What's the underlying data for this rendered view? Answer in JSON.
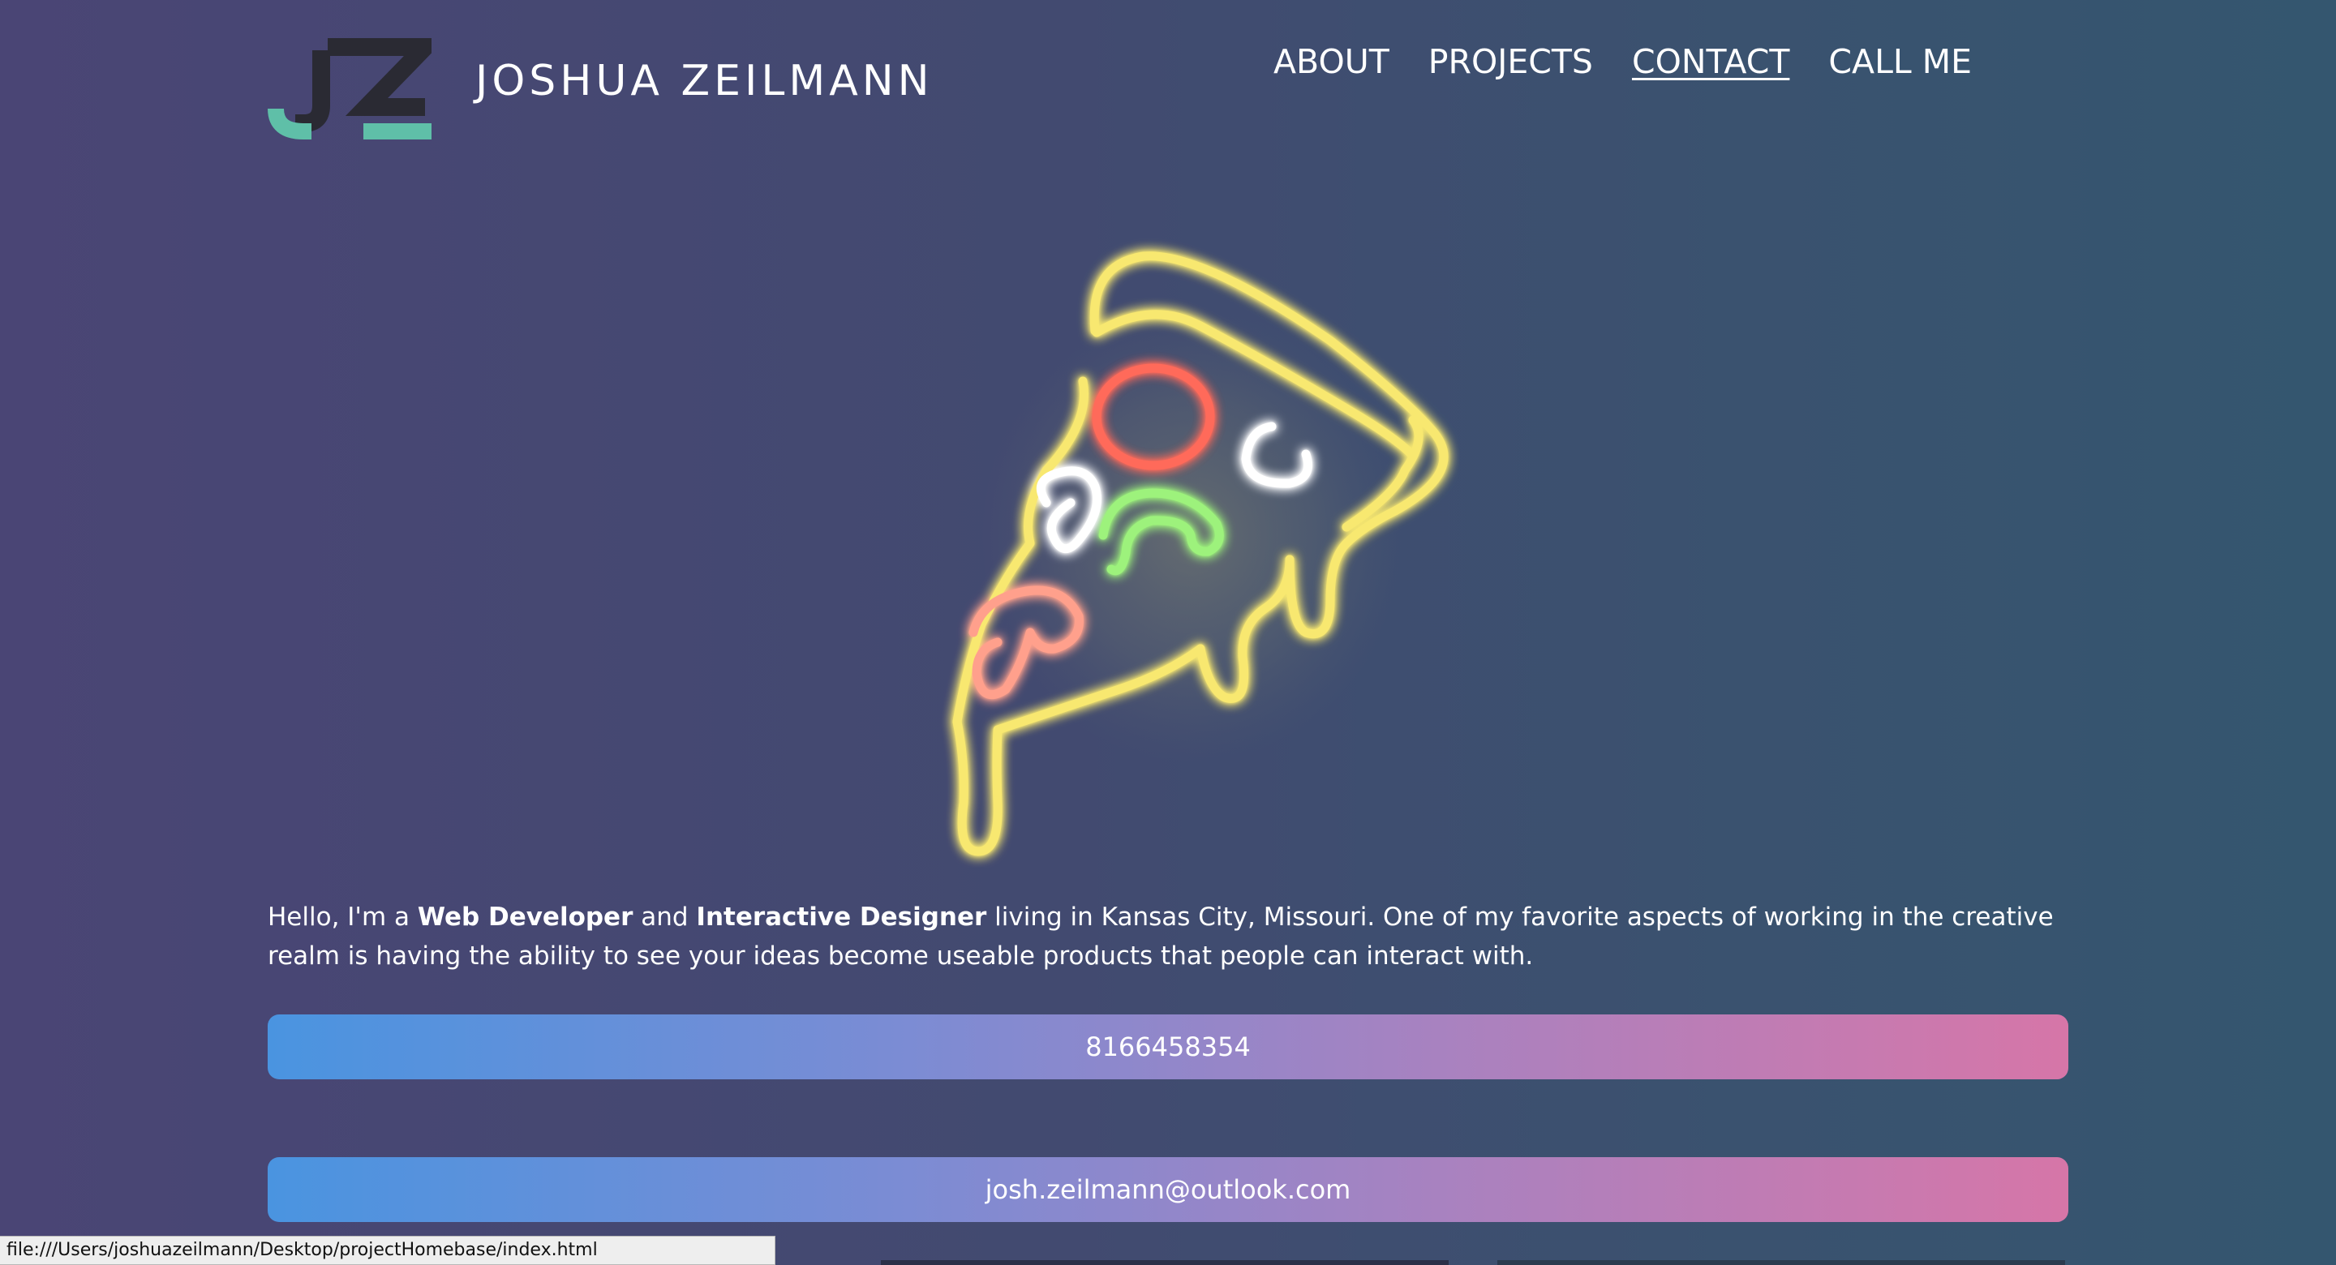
{
  "header": {
    "logo_icon": "jz-monogram-icon",
    "site_name": "JOSHUA ZEILMANN",
    "nav": [
      {
        "label": "ABOUT",
        "active": false
      },
      {
        "label": "PROJECTS",
        "active": false
      },
      {
        "label": "CONTACT",
        "active": true
      },
      {
        "label": "CALL ME",
        "active": false
      }
    ]
  },
  "hero": {
    "illustration": "neon-pizza-slice-icon"
  },
  "intro": {
    "part1": "Hello, I'm a ",
    "role1": "Web Developer",
    "part2": " and ",
    "role2": "Interactive Designer",
    "part3": " living in Kansas City, Missouri. One of my favorite aspects of working in the creative realm is having the ability to see your ideas become useable products that people can interact with."
  },
  "contact": {
    "phone": "8166458354",
    "email": "josh.zeilmann@outlook.com"
  },
  "status_bar": {
    "url": "file:///Users/joshuazeilmann/Desktop/projectHomebase/index.html"
  },
  "colors": {
    "background_start": "#4a4575",
    "background_end": "#34566f",
    "logo_teal": "#5fbfa8",
    "logo_dark": "#2a2a33",
    "button_gradient_start": "#4a94e0",
    "button_gradient_end": "#d676a8",
    "neon_yellow": "#f8e870",
    "neon_red": "#ff6a5a",
    "neon_green": "#9df27c",
    "neon_white": "#ffffff",
    "neon_salmon": "#ffa08c"
  }
}
